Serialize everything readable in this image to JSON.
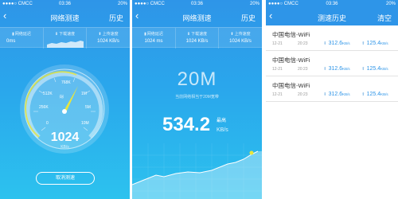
{
  "status": {
    "carrier": "●●●●○ CMCC",
    "time": "03:36",
    "battery": "20%"
  },
  "screen1": {
    "title": "网络测速",
    "history_label": "历史",
    "metrics": [
      {
        "label": "网络延迟",
        "value": "0ms"
      },
      {
        "label": "下载速度",
        "value": ""
      },
      {
        "label": "上传速度",
        "value": "1024 KB/s"
      }
    ],
    "gauge": {
      "ticks": [
        "0",
        "256K",
        "512K",
        "768K",
        "1M",
        "5M",
        "10M"
      ],
      "speed": "1024",
      "unit": "KB/s"
    },
    "cancel_label": "取消测速"
  },
  "screen2": {
    "title": "网络测速",
    "history_label": "历史",
    "metrics": [
      {
        "label": "网络延迟",
        "value": "1024 ms"
      },
      {
        "label": "下载速度",
        "value": "1024 KB/s"
      },
      {
        "label": "上传速度",
        "value": "1024 KB/s"
      }
    ],
    "plan": "20M",
    "plan_desc": "当前网络相当于20M宽带",
    "peak_value": "534.2",
    "peak_label": "最高",
    "peak_unit": "KB/s"
  },
  "screen3": {
    "title": "测速历史",
    "clear_label": "清空",
    "items": [
      {
        "name": "中国电信-WiFi",
        "date": "12-21",
        "time": "20:23",
        "download": "312.6",
        "upload": "125.4",
        "unit": "KB/s"
      },
      {
        "name": "中国电信-WiFi",
        "date": "12-21",
        "time": "20:23",
        "download": "312.6",
        "upload": "125.4",
        "unit": "KB/s"
      },
      {
        "name": "中国电信-WiFi",
        "date": "12-21",
        "time": "20:23",
        "download": "312.6",
        "upload": "125.4",
        "unit": "KB/s"
      }
    ]
  },
  "colors": {
    "primary": "#2e95e8",
    "accent": "#e8e63c",
    "gradient_bottom": "#2cc2ee"
  }
}
